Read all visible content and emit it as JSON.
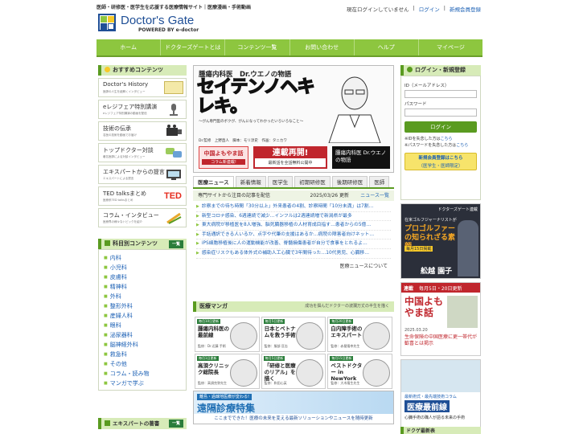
{
  "header": {
    "tagline": "医師・研修医・医学生を応援する医療情報サイト｜医療漫画・手術動画",
    "logo_text": "Doctor's Gate",
    "logo_sub": "POWERED BY e-doctor",
    "status": "現在ログインしていません",
    "login_link": "ログイン",
    "register_link": "新規会員登録"
  },
  "nav": [
    "ホーム",
    "ドクターズゲートとは",
    "コンテンツ一覧",
    "お問い合わせ",
    "ヘルプ",
    "マイページ"
  ],
  "left": {
    "recommend_title": "おすすめコンテンツ",
    "recommend": [
      {
        "title": "Doctor's History",
        "desc": "医師の人生を紐解くインタビュー"
      },
      {
        "title": "eレジフェア特別講演",
        "desc": "eレジフェア特別講演の動画を配信"
      },
      {
        "title": "技術の伝承",
        "desc": "名医の技術を動画でお届け"
      },
      {
        "title": "トップドクター対談",
        "desc": "著名医師による対談インタビュー"
      },
      {
        "title": "エキスパートからの提言",
        "desc": "エキスパートによる提言"
      },
      {
        "title": "TED talksまとめ",
        "desc": "医療系TED talksまとめ"
      },
      {
        "title": "コラム・インタビュー",
        "desc": "医療界の様々なトピックを紹介"
      }
    ],
    "kamoku_title": "科目別コンテンツ",
    "ichiran": "一覧",
    "kamoku": [
      "内科",
      "小児科",
      "皮膚科",
      "精神科",
      "外科",
      "整形外科",
      "産婦人科",
      "眼科",
      "泌尿器科",
      "脳神経外科",
      "救急科",
      "その他",
      "コラム・読み物",
      "マンガで学ぶ"
    ],
    "expert_title": "エキスパートの著書"
  },
  "center": {
    "manga_label1": "腫瘍内科医　Dr.ウエノの物語",
    "manga_title": "セイテンノヘキレキ。",
    "manga_sub": "～がん専門医のボクが、がんになってわかったいろいろなこと～",
    "manga_credits": "Dr.監修　上野直人　脚本：モリ淳史　作画：タニカワ",
    "badge_china": "中国よもやま話",
    "badge_column": "コラム新連載!",
    "badge_serial": "連載再開!",
    "badge_serial_sub": "最新話を全話無料公開中",
    "badge_manga": "腫瘍内科医 Dr.ウエノの物語",
    "tabs": [
      "医療ニュース",
      "新着情報",
      "医学生",
      "初期研修医",
      "後期研修医",
      "医師"
    ],
    "news_head": "専門サイトから注目の記事を配信",
    "news_date": "2025/03/26 更新",
    "news_more": "ニュース一覧",
    "news": [
      "診察までの待ち時間「30分以上」外来患者の4割、診察時間「10分未満」は7割…",
      "新型コロナ感染、6週連続で減少…インフルは2週連続増で新潟県が最多",
      "東大病院が移植医を8人増強、脳死臓器移植の人材育成目指す…患者からの5億…",
      "手話通訳できる人いるか、点字や代筆の支援はあるか…病院の障害者向けネット…",
      "iPS細胞移植後に人の運動機能が改善、脊髄損傷患者が自分で食事をとれるよ…",
      "感染症リスクもある体外式の補助人工心臓で3年間待った…10代男児、心臓移…"
    ],
    "news_footer": "医療ニュースについて",
    "manga_head": "医療マンガ",
    "manga_head_sub": "成功を掴んだドクターの波瀾万丈の半生を描く",
    "cards": [
      {
        "badge": "毎月10日更新",
        "title": "腫瘍内科医の最前線",
        "sub": "監修：Dr.近藤 手術"
      },
      {
        "badge": "毎月5日更新",
        "title": "日本とベトナムを救う手術",
        "sub": "監修：服部 匡志"
      },
      {
        "badge": "毎月20日更新",
        "title": "白内障手術のエキスパート",
        "sub": "監修：赤星隆幸先生"
      },
      {
        "badge": "毎月1日更新",
        "title": "高須クリニック総院長",
        "sub": "監修：高須克弥先生"
      },
      {
        "badge": "毎月5日更新",
        "title": "「研修と医療のリアル」を描く",
        "sub": "監修：和田心英"
      },
      {
        "badge": "毎月15日更新",
        "title": "ベストドクター in NewYork",
        "sub": "監修：大木隆生先生"
      }
    ],
    "banner_tag": "離島・過疎地医療が変わる!",
    "banner_title": "遠隔診療特集",
    "banner_bottom": "ここまでできた！医療の未来を変える最新ソリューションやニュースを随時更新"
  },
  "right": {
    "login_title": "ログイン・新規登録",
    "id_label": "ID（メールアドレス）",
    "pw_label": "パスワード",
    "login_button": "ログイン",
    "forgot_id": "※IDを失念した方は",
    "forgot_pw": "※パスワードを失念した方は",
    "here": "こちら",
    "register_btn_line1": "新規会員登録はこちら",
    "register_btn_line2": "（医学生・医師限定）",
    "ad1_tag": "ドクターズゲート連載",
    "ad1_top": "在米ゴルフジャーナリストが",
    "ad1_title": "プロゴルファーの知られざる素顔",
    "ad1_sub": "毎月15日掲載",
    "ad1_name": "舩越 園子",
    "ad2_tag": "連載",
    "ad2_date": "毎月5日・20日更新",
    "ad2_title": "中国よもやま話",
    "ad2_date2": "2025.03.20",
    "ad2_text": "生命保険の中国医療に更一帯代が歓喜とは掲示",
    "ad3_tag": "最新術式・最先端技術コラム",
    "ad3_title": "医療最前線",
    "ad3_text": "心臓手術の職人が語る未来の手術",
    "bottom_title": "ドクゲ最新表"
  },
  "colors": {
    "accent": "#8dc63f",
    "dark": "#5a9b20",
    "link": "#1a5fb4"
  }
}
